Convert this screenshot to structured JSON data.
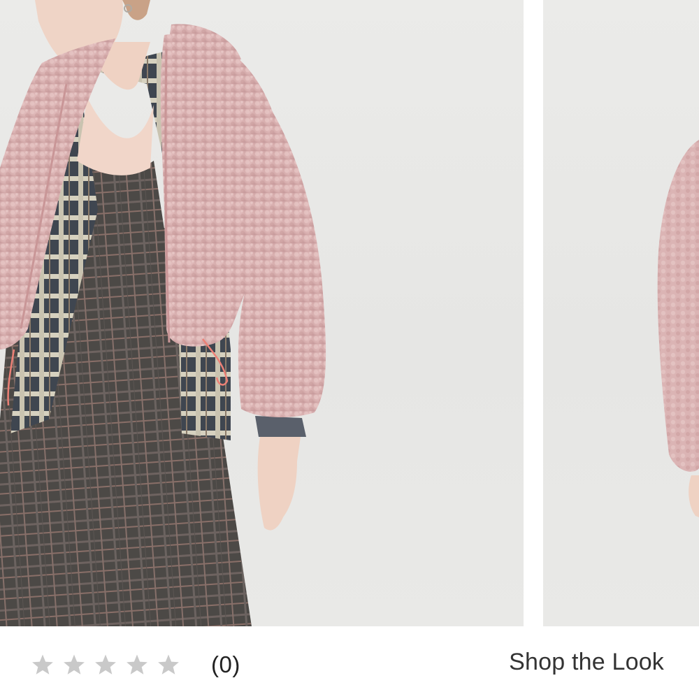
{
  "product_carousel": {
    "slides": [
      {
        "image": "model-front-pink-sherpa-jacket"
      },
      {
        "image": "model-side-pink-sherpa-jacket-partial"
      }
    ]
  },
  "product_info": {
    "rating": {
      "stars_total": 5,
      "stars_filled": 0,
      "star_color": "#c9c9c9",
      "review_count": "(0)"
    },
    "shop_the_look": "Shop the Look"
  },
  "colors": {
    "background": "#ffffff",
    "photo_backdrop": "#e8e8e6",
    "jacket_pink": "#d9b2b3",
    "dress_plaid": "#4a4745",
    "text": "#222222"
  }
}
